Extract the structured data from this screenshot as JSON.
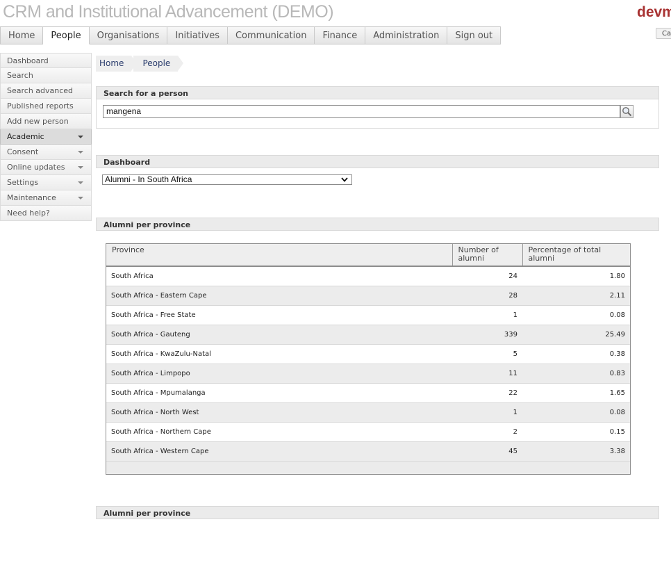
{
  "app": {
    "title": "CRM and Institutional Advancement (DEMO)",
    "brand": "devm",
    "corner_button": "Ca"
  },
  "topnav": [
    {
      "label": "Home"
    },
    {
      "label": "People"
    },
    {
      "label": "Organisations"
    },
    {
      "label": "Initiatives"
    },
    {
      "label": "Communication"
    },
    {
      "label": "Finance"
    },
    {
      "label": "Administration"
    },
    {
      "label": "Sign out"
    }
  ],
  "active_tab": "People",
  "sidebar": [
    {
      "label": "Dashboard"
    },
    {
      "label": "Search"
    },
    {
      "label": "Search advanced"
    },
    {
      "label": "Published reports"
    },
    {
      "label": "Add new person"
    },
    {
      "label": "Academic"
    },
    {
      "label": "Consent"
    },
    {
      "label": "Online updates"
    },
    {
      "label": "Settings"
    },
    {
      "label": "Maintenance"
    },
    {
      "label": "Need help?"
    }
  ],
  "breadcrumb": [
    {
      "label": "Home"
    },
    {
      "label": "People"
    }
  ],
  "search": {
    "heading": "Search for a person",
    "value": "mangena"
  },
  "dashboard": {
    "heading": "Dashboard",
    "selected": "Alumni - In South Africa"
  },
  "report": {
    "heading": "Alumni per province",
    "columns": [
      "Province",
      "Number of alumni",
      "Percentage of total alumni"
    ],
    "rows": [
      [
        "South Africa",
        "24",
        "1.80"
      ],
      [
        "South Africa - Eastern Cape",
        "28",
        "2.11"
      ],
      [
        "South Africa - Free State",
        "1",
        "0.08"
      ],
      [
        "South Africa - Gauteng",
        "339",
        "25.49"
      ],
      [
        "South Africa - KwaZulu-Natal",
        "5",
        "0.38"
      ],
      [
        "South Africa - Limpopo",
        "11",
        "0.83"
      ],
      [
        "South Africa - Mpumalanga",
        "22",
        "1.65"
      ],
      [
        "South Africa - North West",
        "1",
        "0.08"
      ],
      [
        "South Africa - Northern Cape",
        "2",
        "0.15"
      ],
      [
        "South Africa - Western Cape",
        "45",
        "3.38"
      ]
    ]
  },
  "report2": {
    "heading": "Alumni per province"
  },
  "icons": {
    "search": "magnifier-icon",
    "dropdown": "chevron-down-icon",
    "submenu": "caret-down-icon"
  },
  "colors": {
    "brand": "#a83232",
    "title": "#b8b8b8",
    "link": "#2c3e6e"
  }
}
